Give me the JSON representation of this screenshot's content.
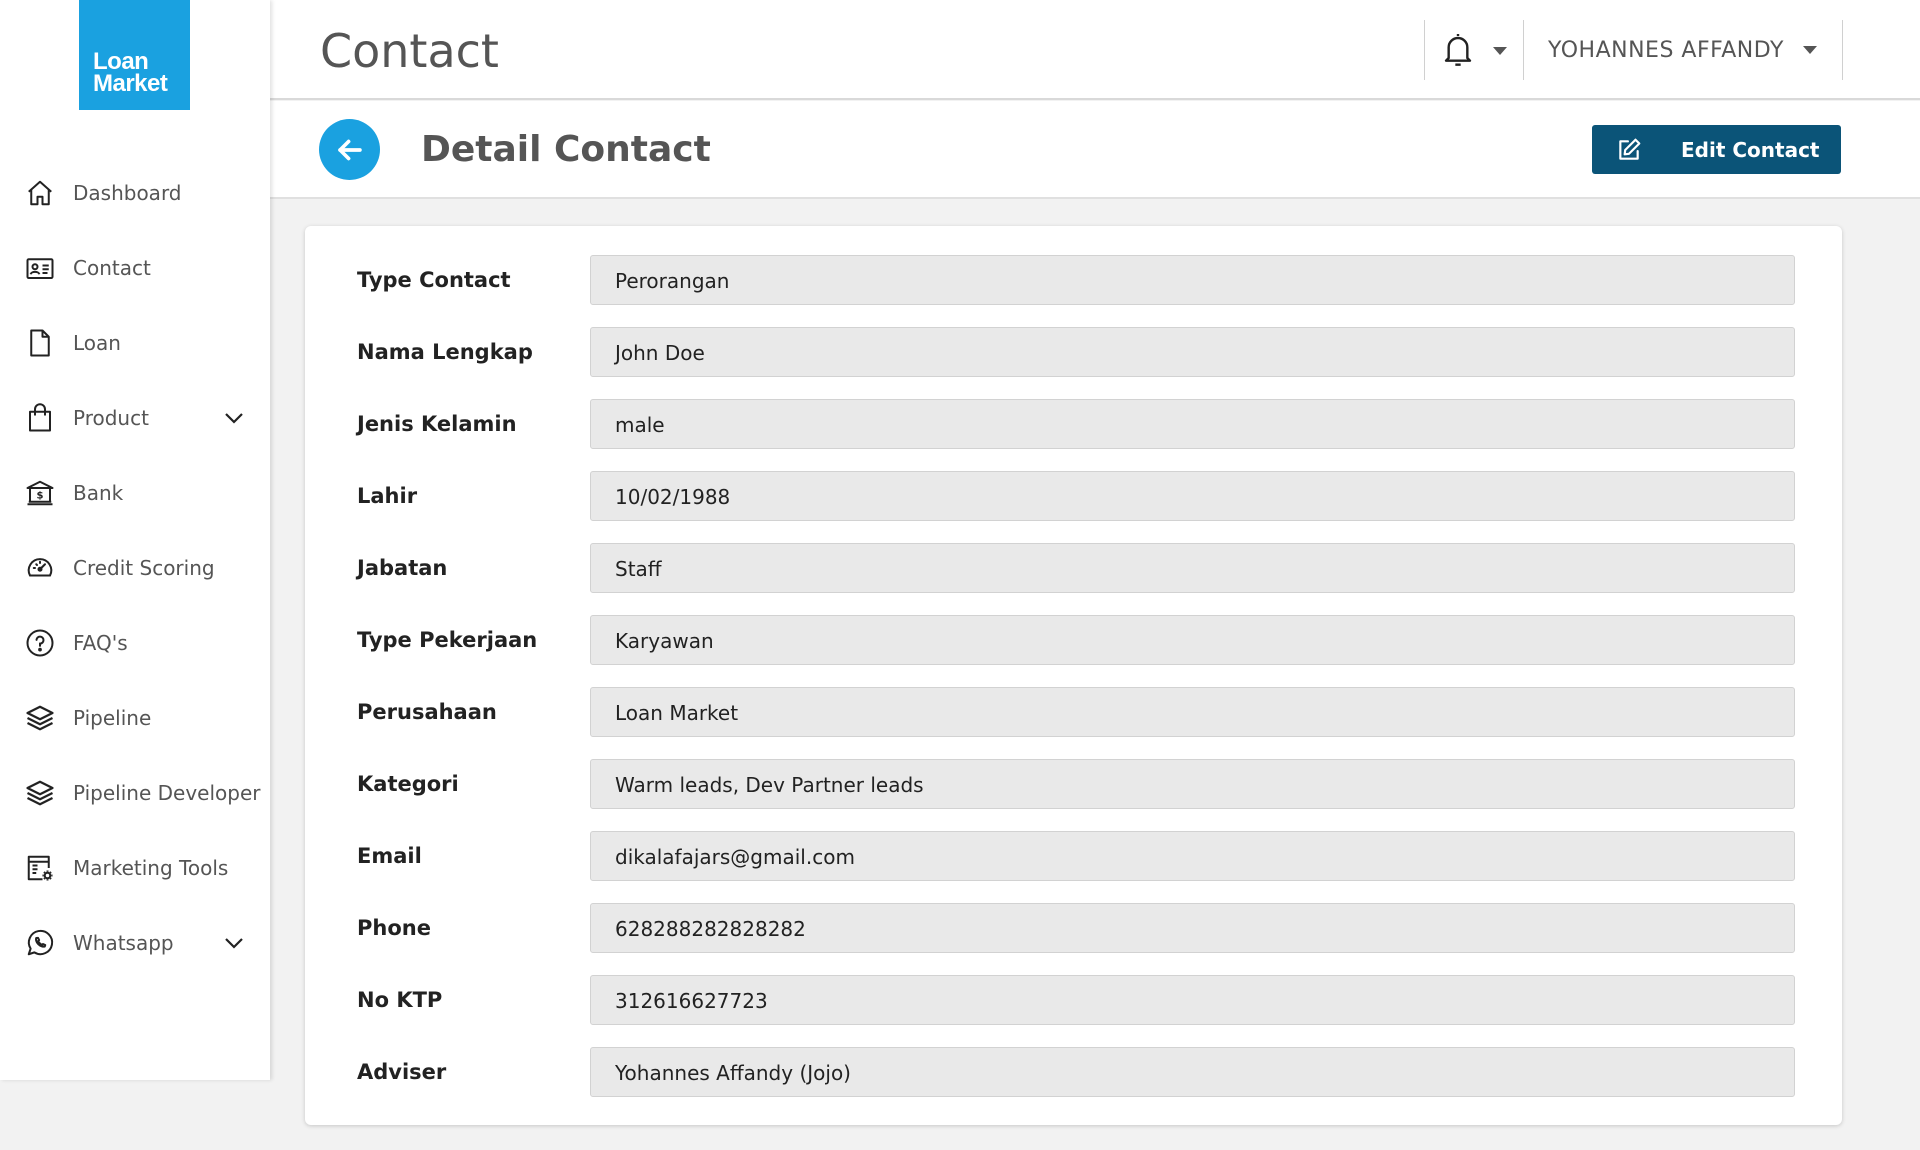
{
  "brand": {
    "logo_line1": "Loan",
    "logo_line2": "Market"
  },
  "sidebar": {
    "items": [
      {
        "label": "Dashboard",
        "icon": "home-icon"
      },
      {
        "label": "Contact",
        "icon": "contact-card-icon"
      },
      {
        "label": "Loan",
        "icon": "document-icon"
      },
      {
        "label": "Product",
        "icon": "shopping-bag-icon",
        "expandable": true
      },
      {
        "label": "Bank",
        "icon": "bank-icon"
      },
      {
        "label": "Credit Scoring",
        "icon": "gauge-icon"
      },
      {
        "label": "FAQ's",
        "icon": "help-circle-icon"
      },
      {
        "label": "Pipeline",
        "icon": "layers-icon"
      },
      {
        "label": "Pipeline Developer",
        "icon": "layers-icon"
      },
      {
        "label": "Marketing Tools",
        "icon": "tools-settings-icon"
      },
      {
        "label": "Whatsapp",
        "icon": "whatsapp-icon",
        "expandable": true
      }
    ]
  },
  "header": {
    "title": "Contact",
    "user_name": "YOHANNES AFFANDY"
  },
  "subheader": {
    "title": "Detail Contact",
    "edit_label": "Edit Contact"
  },
  "detail": {
    "fields": [
      {
        "label": "Type Contact",
        "value": "Perorangan"
      },
      {
        "label": "Nama Lengkap",
        "value": "John Doe"
      },
      {
        "label": "Jenis Kelamin",
        "value": "male"
      },
      {
        "label": "Lahir",
        "value": "10/02/1988"
      },
      {
        "label": "Jabatan",
        "value": "Staff"
      },
      {
        "label": "Type Pekerjaan",
        "value": "Karyawan"
      },
      {
        "label": "Perusahaan",
        "value": "Loan Market"
      },
      {
        "label": "Kategori",
        "value": "Warm leads, Dev Partner leads"
      },
      {
        "label": "Email",
        "value": "dikalafajars@gmail.com"
      },
      {
        "label": "Phone",
        "value": "628288282828282"
      },
      {
        "label": "No KTP",
        "value": "312616627723"
      },
      {
        "label": "Adviser",
        "value": "Yohannes Affandy (Jojo)"
      }
    ]
  },
  "colors": {
    "brand_blue": "#1aa1e0",
    "primary_button": "#0b5478",
    "field_bg": "#e9e9e9"
  }
}
